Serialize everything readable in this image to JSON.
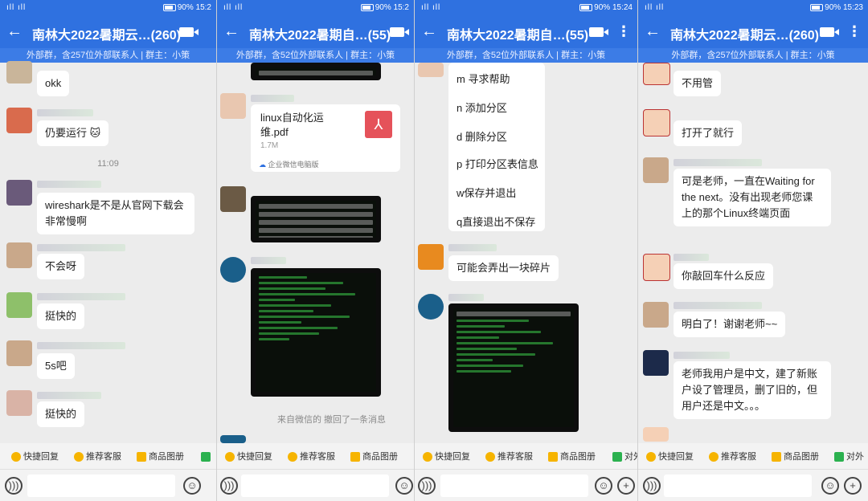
{
  "panels": [
    {
      "status": {
        "battery": "90%",
        "time": "15:2"
      },
      "title": "南林大2022暑期云…(260)",
      "subtitle": "外部群，含257位外部联系人 | 群主：小策",
      "messages": [
        "okk",
        "仍要运行",
        "wireshark是不是从官网下载会非常慢啊",
        "不会呀",
        "挺快的",
        "5s吧",
        "挺快的"
      ],
      "time_divider": "11:09"
    },
    {
      "status": {
        "battery": "90%",
        "time": "15:2"
      },
      "title": "南林大2022暑期自…(55)",
      "subtitle": "外部群，含52位外部联系人 | 群主：小策",
      "file": {
        "name": "linux自动化运维.pdf",
        "size": "1.7M",
        "source": "企业微信电脑版"
      },
      "recall_notice": "来自微信的    撤回了一条消息"
    },
    {
      "status": {
        "battery": "90%",
        "time": "15:24"
      },
      "title": "南林大2022暑期自…(55)",
      "subtitle": "外部群，含52位外部联系人 | 群主：小策",
      "menu": [
        "m 寻求帮助",
        "n 添加分区",
        "d 删除分区",
        "p 打印分区表信息",
        "w保存并退出",
        "q直接退出不保存"
      ],
      "messages": [
        "可能会弄出一块碎片"
      ]
    },
    {
      "status": {
        "battery": "90%",
        "time": "15:23"
      },
      "title": "南林大2022暑期云…(260)",
      "subtitle": "外部群，含257位外部联系人 | 群主：小策",
      "messages": [
        "不用管",
        "打开了就行",
        "可是老师，一直在Waiting for the next。没有出现老师您课上的那个Linux终端页面",
        "你敲回车什么反应",
        "明白了！谢谢老师~~",
        "老师我用户是中文，建了新账户设了管理员，删了旧的，但用户还是中文。。。"
      ]
    }
  ],
  "actions": {
    "quick_reply": "快捷回复",
    "recommend": "推荐客服",
    "catalog": "商品图册",
    "external": "对外"
  }
}
